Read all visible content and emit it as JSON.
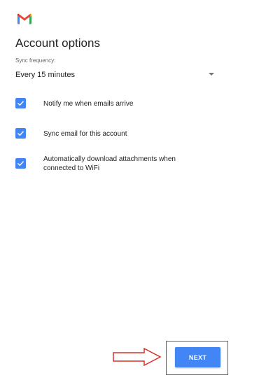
{
  "header": {
    "logo_icon": "gmail-logo-icon",
    "title": "Account options"
  },
  "sync": {
    "label": "Sync frequency:",
    "value": "Every 15 minutes",
    "caret_icon": "dropdown-caret-icon"
  },
  "options": [
    {
      "label": "Notify me when emails arrive",
      "checked": true
    },
    {
      "label": "Sync email for this account",
      "checked": true
    },
    {
      "label": "Automatically download attachments when connected to WiFi",
      "checked": true
    }
  ],
  "footer": {
    "next_label": "NEXT"
  },
  "annotation": {
    "arrow_icon": "right-arrow-icon",
    "highlight_color": "#d93025"
  },
  "colors": {
    "accent": "#4285f4",
    "text_primary": "#202124",
    "text_secondary": "#5f6368"
  }
}
